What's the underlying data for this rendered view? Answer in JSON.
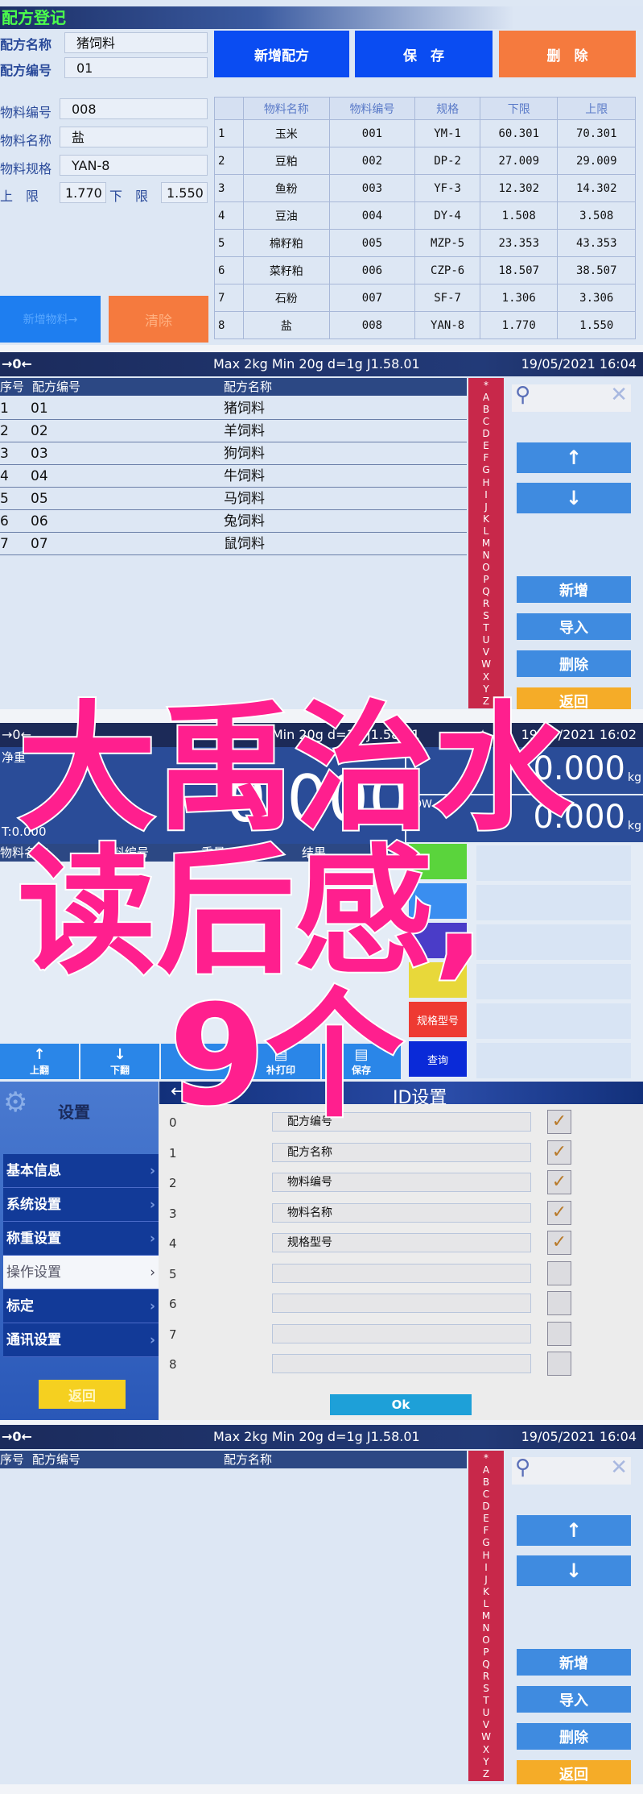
{
  "recipe": {
    "title": "配方登记",
    "recipe_name_label": "配方名称",
    "recipe_name": "猪饲料",
    "recipe_no_label": "配方编号",
    "recipe_no": "01",
    "buttons": {
      "new_recipe": "新增配方",
      "save": "保　存",
      "delete": "删　除",
      "new_material": "新增物料→",
      "clear": "清除"
    },
    "material_no_label": "物料编号",
    "material_no": "008",
    "material_name_label": "物料名称",
    "material_name": "盐",
    "material_spec_label": "物料规格",
    "material_spec": "YAN-8",
    "upper_label": "上　限",
    "upper": "1.770",
    "lower_label": "下　限",
    "lower": "1.550",
    "columns": [
      "",
      "物料名称",
      "物料编号",
      "规格",
      "下限",
      "上限"
    ],
    "rows": [
      [
        "1",
        "玉米",
        "001",
        "YM-1",
        "60.301",
        "70.301"
      ],
      [
        "2",
        "豆粕",
        "002",
        "DP-2",
        "27.009",
        "29.009"
      ],
      [
        "3",
        "鱼粉",
        "003",
        "YF-3",
        "12.302",
        "14.302"
      ],
      [
        "4",
        "豆油",
        "004",
        "DY-4",
        "1.508",
        "3.508"
      ],
      [
        "5",
        "棉籽粕",
        "005",
        "MZP-5",
        "23.353",
        "43.353"
      ],
      [
        "6",
        "菜籽粕",
        "006",
        "CZP-6",
        "18.507",
        "38.507"
      ],
      [
        "7",
        "石粉",
        "007",
        "SF-7",
        "1.306",
        "3.306"
      ],
      [
        "8",
        "盐",
        "008",
        "YAN-8",
        "1.770",
        "1.550"
      ]
    ]
  },
  "list": {
    "zero": "→0←",
    "spec": "Max 2kg  Min 20g  d=1g    J1.58.01",
    "datetime": "19/05/2021  16:04",
    "columns": [
      "序号",
      "配方编号",
      "配方名称"
    ],
    "rows": [
      [
        "1",
        "01",
        "猪饲料"
      ],
      [
        "2",
        "02",
        "羊饲料"
      ],
      [
        "3",
        "03",
        "狗饲料"
      ],
      [
        "4",
        "04",
        "牛饲料"
      ],
      [
        "5",
        "05",
        "马饲料"
      ],
      [
        "6",
        "06",
        "兔饲料"
      ],
      [
        "7",
        "07",
        "鼠饲料"
      ]
    ],
    "alphabet": [
      "*",
      "A",
      "B",
      "C",
      "D",
      "E",
      "F",
      "G",
      "H",
      "I",
      "J",
      "K",
      "L",
      "M",
      "N",
      "O",
      "P",
      "Q",
      "R",
      "S",
      "T",
      "U",
      "V",
      "W",
      "X",
      "Y",
      "Z"
    ],
    "buttons": {
      "add": "新增",
      "import": "导入",
      "delete": "删除",
      "back": "返回"
    }
  },
  "weigh": {
    "zero": "→0←",
    "spec": "Max 2kg  Min 20g  d=1g    J1.58.01",
    "datetime": "19/05/2021  16:02",
    "net_label": "净重",
    "net_value": "0.000",
    "tare": "T:0.000",
    "high_value": "0.000",
    "low_label": "LOW",
    "low_value": "0.000",
    "unit": "kg",
    "columns": [
      "物料名称",
      "物料编号",
      "重量",
      "结果"
    ],
    "side_buttons": [
      {
        "label": "",
        "color": "#5ad43c"
      },
      {
        "label": "",
        "color": "#3a8ef0"
      },
      {
        "label": "",
        "color": "#4a3cc8"
      },
      {
        "label": "",
        "color": "#e8d83a"
      },
      {
        "label": "规格型号",
        "color": "#ee3a32"
      },
      {
        "label": "查询",
        "color": "#0a2ad8"
      }
    ],
    "toolbar": [
      "上翻",
      "下翻",
      "",
      "补打印",
      "保存"
    ]
  },
  "settings": {
    "title": "设置",
    "menu": [
      "基本信息",
      "系统设置",
      "称重设置",
      "操作设置",
      "标定",
      "通讯设置"
    ],
    "active": 3,
    "back": "返回",
    "page_title": "ID设置",
    "fields": [
      {
        "n": "0",
        "v": "配方编号",
        "c": true
      },
      {
        "n": "1",
        "v": "配方名称",
        "c": true
      },
      {
        "n": "2",
        "v": "物料编号",
        "c": true
      },
      {
        "n": "3",
        "v": "物料名称",
        "c": true
      },
      {
        "n": "4",
        "v": "规格型号",
        "c": true
      },
      {
        "n": "5",
        "v": "",
        "c": false
      },
      {
        "n": "6",
        "v": "",
        "c": false
      },
      {
        "n": "7",
        "v": "",
        "c": false
      },
      {
        "n": "8",
        "v": "",
        "c": false
      }
    ],
    "ok": "Ok"
  },
  "list2": {
    "zero": "→0←",
    "spec": "Max 2kg  Min 20g  d=1g    J1.58.01",
    "datetime": "19/05/2021  16:04",
    "columns": [
      "序号",
      "配方编号",
      "配方名称"
    ]
  },
  "overlay": {
    "line1": "大禹治水",
    "line2": "读后感,",
    "line3": "9个",
    "color": "#ff1f8e"
  }
}
